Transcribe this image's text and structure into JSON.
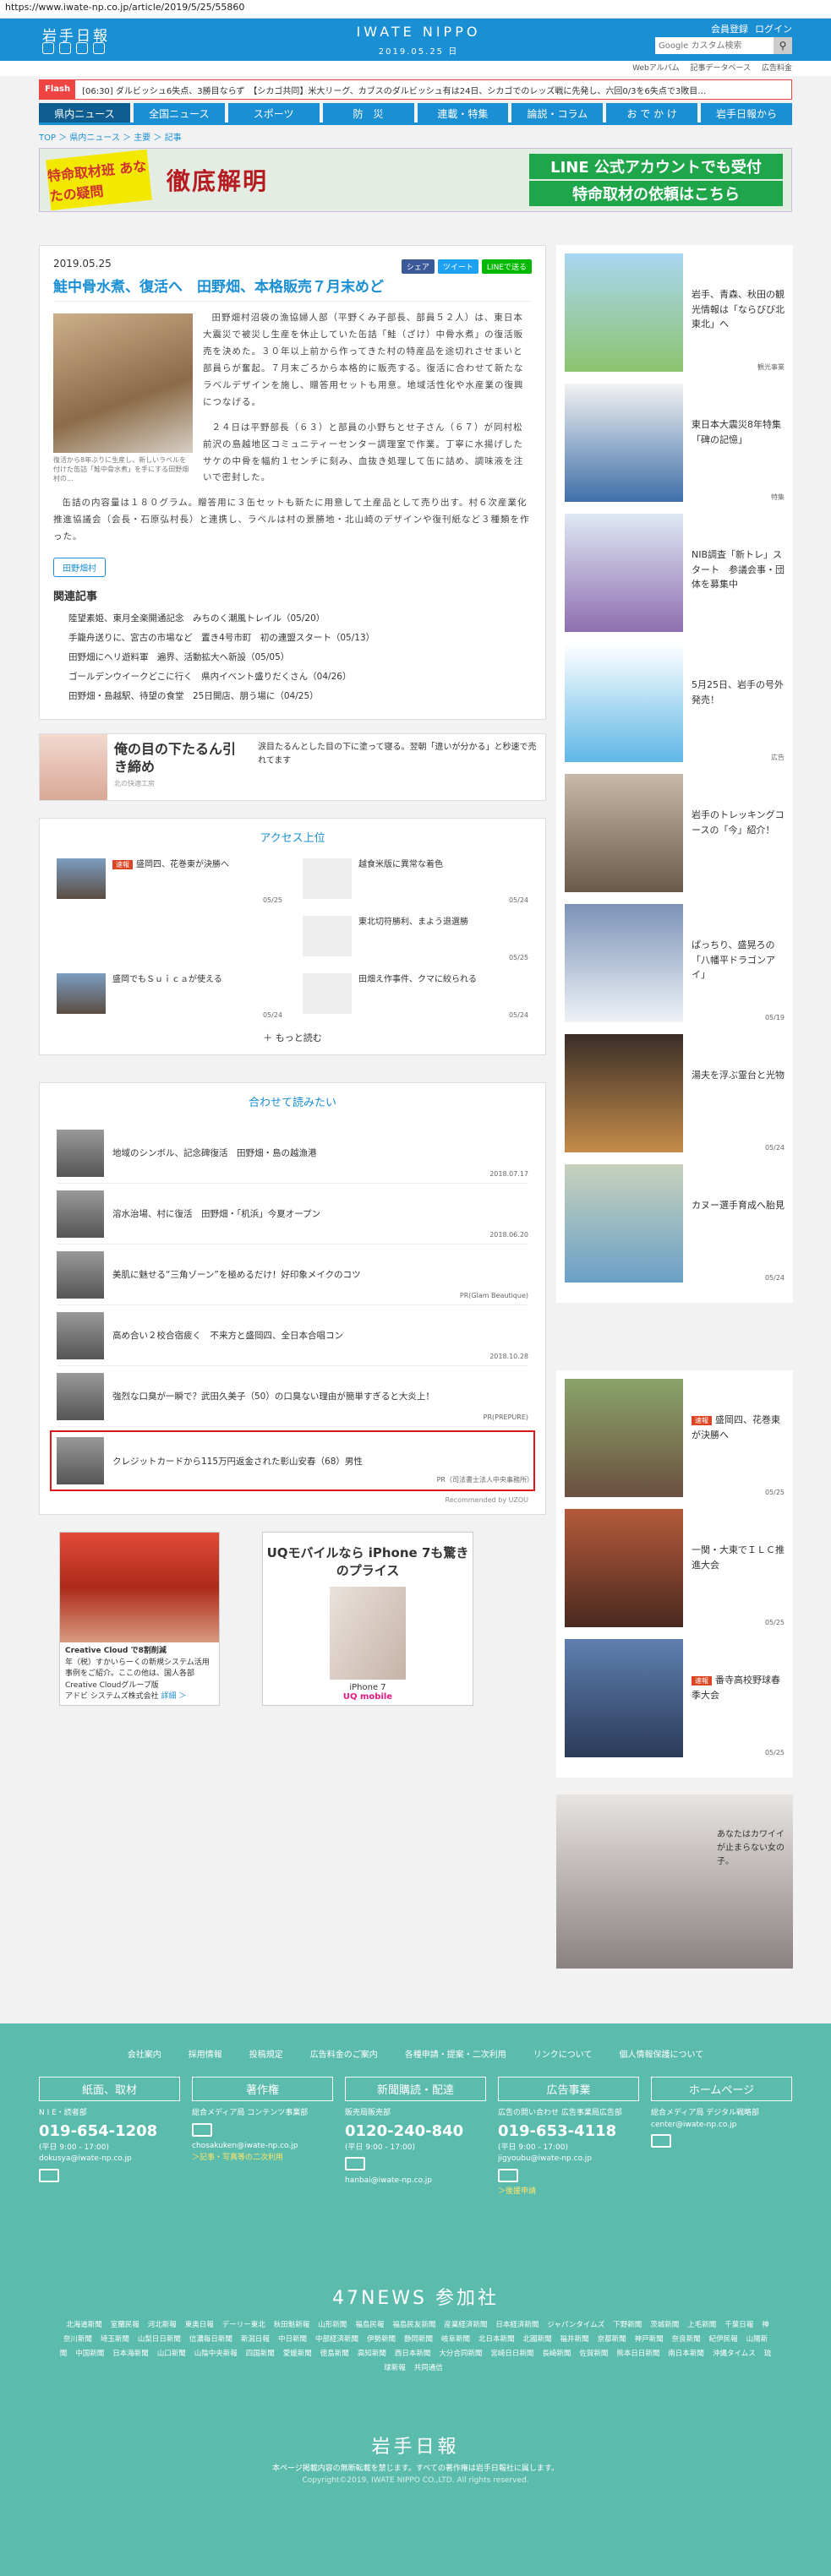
{
  "browser": {
    "url": "https://www.iwate-np.co.jp/article/2019/5/25/55860"
  },
  "header": {
    "logo": "岩手日報",
    "title": "IWATE NIPPO",
    "date": "2019.05.25 日",
    "member_register": "会員登録",
    "login": "ログイン",
    "search_placeholder": "Google カスタム検索"
  },
  "sublinks": [
    "Webアルバム",
    "記事データベース",
    "広告料金"
  ],
  "flash": {
    "tag": "Flash",
    "text": "[06:30] ダルビッシュ6失点、3勝目ならず　【シカゴ共同】米大リーグ、カブスのダルビッシュ有は24日、シカゴでのレッズ戦に先発し、六回0/3を6失点で3敗目…"
  },
  "nav": [
    "県内ニュース",
    "全国ニュース",
    "スポーツ",
    "防　災",
    "連載・特集",
    "論説・コラム",
    "お で か け",
    "岩手日報から"
  ],
  "breadcrumb": "TOP ＞ 県内ニュース ＞ 主要 ＞ 記事",
  "banner": {
    "badge": "特命取材班 あなたの疑問",
    "headline": "徹底解明",
    "line1": "LINE 公式アカウントでも受付",
    "line2": "特命取材の依頼はこちら"
  },
  "article": {
    "date": "2019.05.25",
    "share": [
      "シェア",
      "ツイート",
      "LINEで送る"
    ],
    "title": "鮭中骨水煮、復活へ　田野畑、本格販売７月末めど",
    "photo_caption": "復活から8年ぶりに生産し、新しいラベルを付けた缶詰「鮭中骨水煮」を手にする田野畑村の…",
    "p1": "田野畑村沼袋の漁協婦人部（平野くみ子部長、部員５２人）は、東日本大震災で被災し生産を休止していた缶詰「鮭（ざけ）中骨水煮」の復活販売を決めた。３０年以上前から作ってきた村の特産品を途切れさせまいと部員らが奮起。７月末ごろから本格的に販売する。復活に合わせて新たなラベルデザインを施し、贈答用セットも用意。地域活性化や水産業の復興につなげる。",
    "p2": "２４日は平野部長（６３）と部員の小野ちとせ子さん（６７）が同村松前沢の島越地区コミュニティーセンター調理室で作業。丁寧に水揚げしたサケの中骨を幅約１センチに刻み、血抜き処理して缶に詰め、調味液を注いで密封した。",
    "p3": "缶詰の内容量は１８０グラム。贈答用に３缶セットも新たに用意して土産品として売り出す。村６次産業化推進協議会（会長・石原弘村長）と連携し、ラベルは村の景勝地・北山崎のデザインや復刊紙など３種類を作った。",
    "tag": "田野畑村",
    "related_title": "関連記事",
    "related": [
      "陸望素姫、東月全楽開通記念　みちのく潮風トレイル（05/20）",
      "手籠舟送りに、宮古の市場など　置き4号市町　初の連盟スタート（05/13）",
      "田野畑にヘリ遊料軍　遍界、活動拡大へ新設（05/05）",
      "ゴールデンウイークどこに行く　県内イベント盛りだくさん（04/26）",
      "田野畑・島越駅、待望の食堂　25日開店、朋う場に（04/25）"
    ]
  },
  "ad1": {
    "title": "俺の目の下たるん引き締め",
    "sub": "北の快適工房",
    "text": "涙目たるんとした目の下に塗って寝る。翌朝「違いが分かる」と秒速で売れてます"
  },
  "access": {
    "title": "アクセス上位",
    "items": [
      {
        "badge": "速報",
        "title": "盛岡四、花巻東が決勝へ",
        "date": "05/25"
      },
      {
        "badge": "",
        "title": "越食米版に異常な着色",
        "date": "05/24"
      },
      {
        "badge": "",
        "title": "",
        "date": ""
      },
      {
        "badge": "",
        "title": "東北切符勝利、まよう退選勝",
        "date": "05/25"
      },
      {
        "badge": "",
        "title": "盛岡でもＳｕｉｃａが使える",
        "date": "05/24"
      },
      {
        "badge": "",
        "title": "田畑え作事件、クマに絞られる",
        "date": "05/24"
      }
    ],
    "more": "もっと読む"
  },
  "recommend": {
    "title": "合わせて読みたい",
    "items": [
      {
        "title": "地域のシンボル、記念碑復活　田野畑・島の越漁港",
        "date": "2018.07.17"
      },
      {
        "title": "溶水治場、村に復活　田野畑・「机浜」今夏オープン",
        "date": "2018.06.20"
      },
      {
        "title": "美肌に魅せる“三角ゾーン”を極めるだけ！好印象メイクのコツ",
        "date": "PR(Glam Beautique)"
      },
      {
        "title": "高め合い２校合宿疲く　不来方と盛岡四、全日本合唱コン",
        "date": "2018.10.28"
      },
      {
        "title": "強烈な口臭が一瞬で？武田久美子（50）の口臭ない理由が簡単すぎると大炎上！",
        "date": "PR(PREPURE)"
      },
      {
        "title": "クレジットカードから115万円返金された彰山安春（68）男性",
        "date": "PR（司法書士法人中央事務所）"
      }
    ],
    "by": "Recommended by UZOU"
  },
  "ad2": {
    "a_title": "Creative Cloud で8割削減",
    "a_text": "年（税）すかいらーくの新規システム活用事例をご紹介。ここの他は、国人各部Creative Cloudグループ版",
    "a_company": "アドビ システムズ株式会社",
    "a_more": "詳細 ＞",
    "b_head": "UQモバイルなら iPhone 7も驚きのプライス",
    "b_brand": "UQ mobile",
    "b_phone": "iPhone 7"
  },
  "side": [
    {
      "title": "岩手、青森、秋田の観光情報は「ならびび北東北」へ",
      "date": "観光事業"
    },
    {
      "title": "東日本大震災8年特集「碑の記憶」",
      "date": "特集"
    },
    {
      "title": "NIB調査「新トレ」スタート　参議会事・団体を募集中",
      "date": ""
    },
    {
      "title": "5月25日、岩手の号外発売！",
      "date": "広告"
    },
    {
      "title": "岩手のトレッキングコースの「今」紹介！",
      "date": ""
    },
    {
      "title": "ぱっちり、盛晃ろの「八幡平ドラゴンアイ」",
      "date": "05/19"
    },
    {
      "title": "湯夫を浮ぶ霊台と光物",
      "date": "05/24"
    },
    {
      "title": "カヌー選手育成へ胎見",
      "date": "05/24"
    },
    {
      "title": "盛岡四、花巻東が決勝へ",
      "date": "05/25",
      "badge": "速報"
    },
    {
      "title": "一関・大東でＩＬＣ推進大会",
      "date": "05/25"
    },
    {
      "title": "番寺高校野球春季大会",
      "date": "05/25",
      "badge": "速報"
    }
  ],
  "side_ad": "あなたはカワイイが止まらない女の子。",
  "footer": {
    "links": [
      "会社案内",
      "採用情報",
      "投稿規定",
      "広告料金のご案内",
      "各種申請・提案・二次利用",
      "リンクについて",
      "個人情報保護について"
    ],
    "cols": [
      {
        "head": "紙面、取材",
        "dept": "N I E・読者部",
        "tel": "019-654-1208",
        "hours": "(平日 9:00 - 17:00)",
        "mail": "dokusya@iwate-np.co.jp",
        "link": ""
      },
      {
        "head": "著作権",
        "dept": "総合メディア局 コンテンツ事業部",
        "tel": "",
        "hours": "",
        "mail": "chosakuken@iwate-np.co.jp",
        "link": "＞記事・写真等の二次利用"
      },
      {
        "head": "新聞購読・配達",
        "dept": "販売局販売部",
        "tel": "0120-240-840",
        "hours": "(平日 9:00 - 17:00)",
        "mail": "hanbai@iwate-np.co.jp",
        "link": ""
      },
      {
        "head": "広告事業",
        "dept": "広告の問い合わせ 広告事業局広告部",
        "tel": "019-653-4118",
        "hours": "(平日 9:00 - 17:00)",
        "mail": "jigyoubu@iwate-np.co.jp",
        "link": "＞後援申請"
      },
      {
        "head": "ホームページ",
        "dept": "総合メディア局 デジタル戦略部",
        "tel": "",
        "hours": "",
        "mail": "center@iwate-np.co.jp",
        "link": ""
      }
    ],
    "n47": "47NEWS 参加社",
    "papers": [
      "北海道新聞",
      "室蘭民報",
      "河北新報",
      "東奥日報",
      "デーリー東北",
      "秋田魁新報",
      "山形新聞",
      "福島民報",
      "福島民友新聞",
      "産業経済新聞",
      "日本経済新聞",
      "ジャパンタイムズ",
      "下野新聞",
      "茨城新聞",
      "上毛新聞",
      "千葉日報",
      "神奈川新聞",
      "埼玉新聞",
      "山梨日日新聞",
      "信濃毎日新聞",
      "新潟日報",
      "中日新聞",
      "中部経済新聞",
      "伊勢新聞",
      "静岡新聞",
      "岐阜新聞",
      "北日本新聞",
      "北國新聞",
      "福井新聞",
      "京都新聞",
      "神戸新聞",
      "奈良新聞",
      "紀伊民報",
      "山陽新聞",
      "中国新聞",
      "日本海新聞",
      "山口新聞",
      "山陰中央新報",
      "四国新聞",
      "愛媛新聞",
      "徳島新聞",
      "高知新聞",
      "西日本新聞",
      "大分合同新聞",
      "宮崎日日新聞",
      "長崎新聞",
      "佐賀新聞",
      "熊本日日新聞",
      "南日本新聞",
      "沖縄タイムス",
      "琉球新報",
      "共同通信"
    ],
    "logo": "岩手日報",
    "note": "本ページ掲載内容の無断転載を禁じます。すべての著作権は岩手日報社に属します。",
    "copyright": "Copyright©2019, IWATE NIPPO CO.,LTD. All rights reserved."
  }
}
